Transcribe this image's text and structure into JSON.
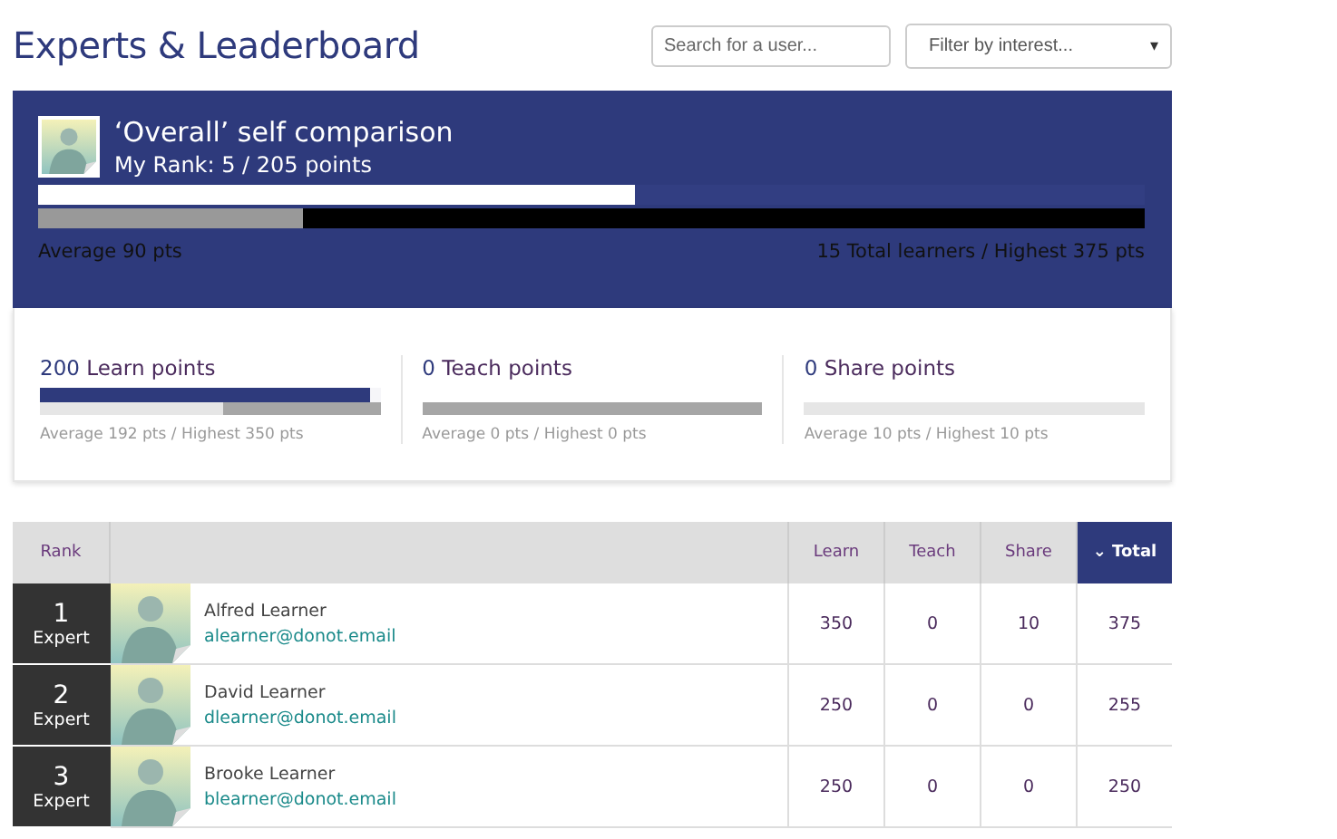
{
  "header": {
    "title": "Experts & Leaderboard",
    "search": {
      "placeholder": "Search for a user..."
    },
    "filter": {
      "value": "Filter by interest...",
      "caret": "▾"
    }
  },
  "overview": {
    "title": "‘Overall’ self comparison",
    "rank": "My Rank: 5 / 205 points",
    "bars": [
      {
        "kind": "mine",
        "level": 0.54
      },
      {
        "kind": "average",
        "level": 0.24
      }
    ],
    "average": "Average 90 pts",
    "summary": "15 Total learners / Highest 375 pts"
  },
  "stats": [
    {
      "value": "200",
      "label": "Learn points",
      "bars": [
        {
          "kind": "mine",
          "level": 0.97
        },
        {
          "kind": "average",
          "level": 0.46
        }
      ],
      "note": "Average 192 pts / Highest 350 pts"
    },
    {
      "value": "0",
      "label": "Teach points",
      "bars": [
        {
          "kind": "average",
          "level": 1
        }
      ],
      "note": "Average 0 pts / Highest 0 pts"
    },
    {
      "value": "0",
      "label": "Share points",
      "bars": [
        {
          "kind": "empty"
        }
      ],
      "note": "Average 10 pts / Highest 10 pts"
    }
  ],
  "table": {
    "columns": [
      {
        "label": "Rank",
        "selected": false
      },
      {
        "selected": false
      },
      {
        "label": "Learn",
        "selected": false
      },
      {
        "label": "Teach",
        "selected": false
      },
      {
        "label": "Share",
        "selected": false
      },
      {
        "label": "Total",
        "selected": true,
        "sort_icon": "⌄"
      }
    ],
    "rows": [
      {
        "rank": "1",
        "level": "Expert",
        "name": "Alfred Learner",
        "email": "alearner@donot.email",
        "learn": "350",
        "teach": "0",
        "share": "10",
        "total": "375"
      },
      {
        "rank": "2",
        "level": "Expert",
        "name": "David Learner",
        "email": "dlearner@donot.email",
        "learn": "250",
        "teach": "0",
        "share": "0",
        "total": "255"
      },
      {
        "rank": "3",
        "level": "Expert",
        "name": "Brooke Learner",
        "email": "blearner@donot.email",
        "learn": "250",
        "teach": "0",
        "share": "0",
        "total": "250"
      }
    ]
  }
}
